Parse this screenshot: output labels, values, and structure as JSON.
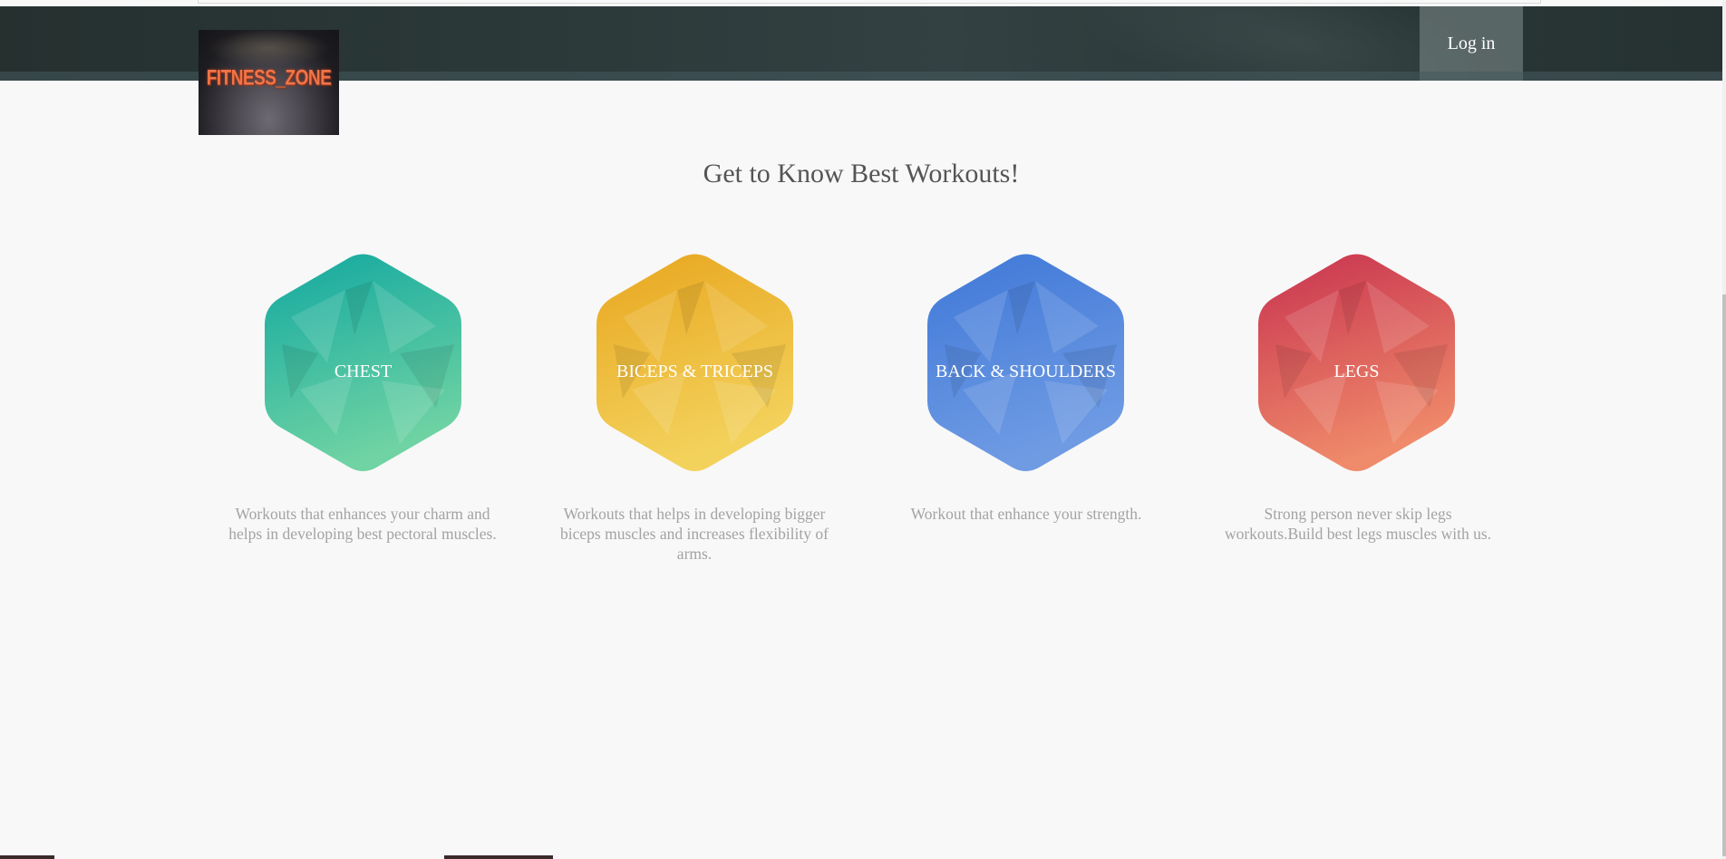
{
  "header": {
    "login_label": "Log in"
  },
  "logo": {
    "text": "FITNESS_ZONE"
  },
  "main": {
    "title": "Get to Know Best Workouts!",
    "workouts": [
      {
        "label": "CHEST",
        "description": "Workouts that enhances your charm and helps in developing best pectoral muscles.",
        "color_top": "#12a8a0",
        "color_bottom": "#6fd3a3"
      },
      {
        "label": "BICEPS & TRICEPS",
        "description": "Workouts that helps in developing bigger biceps muscles and increases flexibility of arms.",
        "color_top": "#e8a61f",
        "color_bottom": "#f3d25c"
      },
      {
        "label": "BACK & SHOULDERS",
        "description": "Workout that enhance your strength.",
        "color_top": "#3f78d8",
        "color_bottom": "#6f9be3"
      },
      {
        "label": "LEGS",
        "description": "Strong person never skip legs workouts.Build best legs muscles with us.",
        "color_top": "#c8324f",
        "color_bottom": "#ef8a6a"
      }
    ]
  }
}
